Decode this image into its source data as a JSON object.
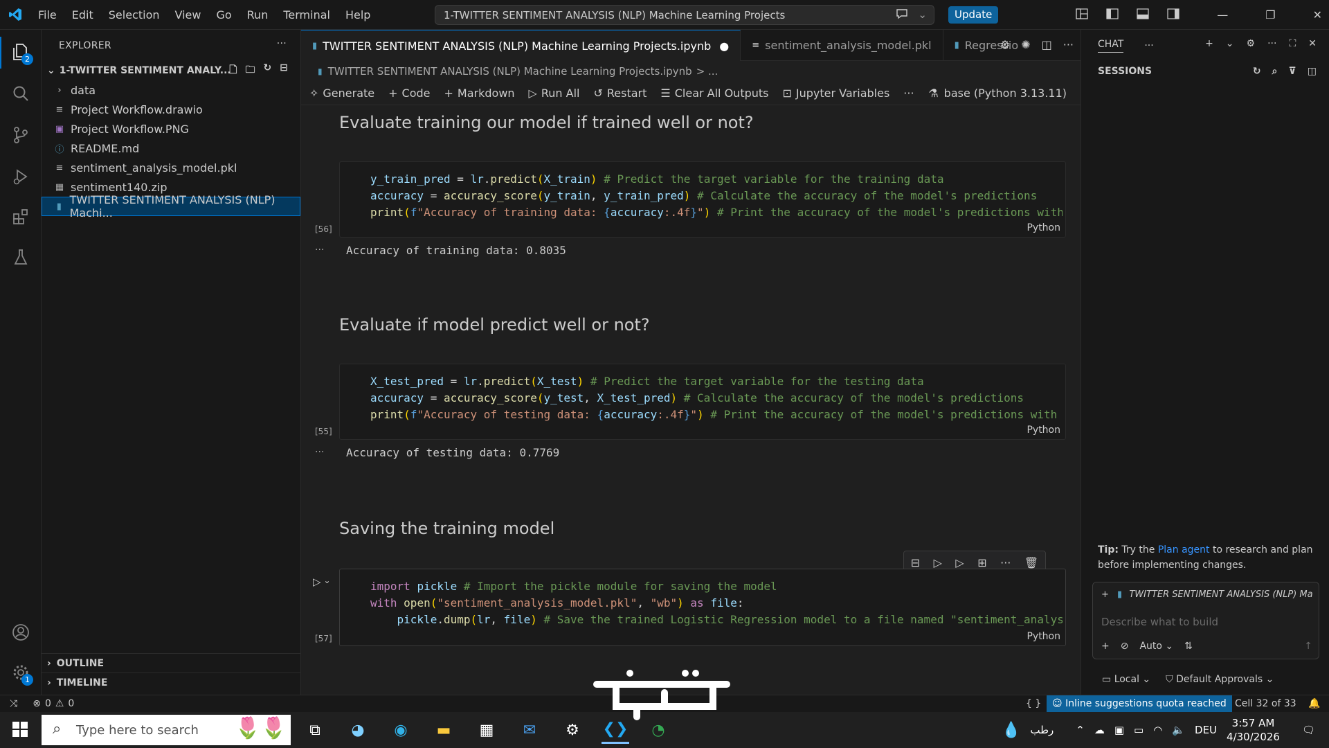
{
  "titlebar": {
    "menu": [
      "File",
      "Edit",
      "Selection",
      "View",
      "Go",
      "Run",
      "Terminal",
      "Help"
    ],
    "search_text": "1-TWITTER SENTIMENT ANALYSIS (NLP) Machine Learning Projects",
    "update_label": "Update"
  },
  "activity": {
    "explorer_badge": "2",
    "settings_badge": "1"
  },
  "explorer": {
    "title": "EXPLORER",
    "folder": "1-TWITTER SENTIMENT ANALY...",
    "files": [
      {
        "name": "data",
        "icon": "chevron-right-icon"
      },
      {
        "name": "Project Workflow.drawio",
        "icon": "file-lines-icon"
      },
      {
        "name": "Project Workflow.PNG",
        "icon": "image-icon"
      },
      {
        "name": "README.md",
        "icon": "info-icon"
      },
      {
        "name": "sentiment_analysis_model.pkl",
        "icon": "file-lines-icon"
      },
      {
        "name": "sentiment140.zip",
        "icon": "archive-icon"
      },
      {
        "name": "TWITTER SENTIMENT ANALYSIS (NLP)  Machi...",
        "icon": "notebook-icon"
      }
    ],
    "outline": "OUTLINE",
    "timeline": "TIMELINE"
  },
  "tabs": [
    {
      "label": "TWITTER SENTIMENT ANALYSIS (NLP) Machine Learning Projects.ipynb",
      "dirty": "●"
    },
    {
      "label": "sentiment_analysis_model.pkl"
    },
    {
      "label": "Regressio"
    }
  ],
  "breadcrumb": {
    "file": "TWITTER SENTIMENT ANALYSIS (NLP)  Machine Learning Projects.ipynb",
    "rest": "> ..."
  },
  "nbtoolbar": {
    "generate": "Generate",
    "code": "Code",
    "markdown": "Markdown",
    "run_all": "Run All",
    "restart": "Restart",
    "clear_outputs": "Clear All Outputs",
    "jupyter_vars": "Jupyter Variables",
    "more": "···",
    "kernel": "base (Python 3.13.11)"
  },
  "notebook": {
    "md1": "Evaluate training our model if trained well or not?",
    "cell1_exec": "[56]",
    "cell1_lang": "Python",
    "out1": "Accuracy of training data: 0.8035",
    "md2": "Evaluate if model predict well or not?",
    "cell2_exec": "[55]",
    "cell2_lang": "Python",
    "out2": "Accuracy of testing data: 0.7769",
    "md3": "Saving the training model",
    "cell3_exec": "[57]",
    "cell3_lang": "Python",
    "out_dots": "···"
  },
  "chat": {
    "title": "CHAT",
    "sessions": "SESSIONS",
    "tip_label": "Tip:",
    "tip_pre": " Try the ",
    "tip_link": "Plan agent",
    "tip_post": " to research and plan before implementing changes.",
    "context": "TWITTER SENTIMENT ANALYSIS (NLP) Mach",
    "placeholder": "Describe what to build",
    "mode": "Auto",
    "local": "Local",
    "approvals": "Default Approvals"
  },
  "statusbar": {
    "errors": "0",
    "warnings": "0",
    "braces": "{ }",
    "quota": "Inline suggestions quota reached",
    "cell_info": "Cell 32 of 33"
  },
  "taskbar": {
    "search_placeholder": "Type here to search",
    "weather": "رطب",
    "lang": "DEU",
    "time": "3:57 AM",
    "date": "4/30/2026"
  },
  "colors": {
    "accent": "#0078d4",
    "update": "#0e639c",
    "bg": "#1f1f1f",
    "panel": "#181818"
  }
}
